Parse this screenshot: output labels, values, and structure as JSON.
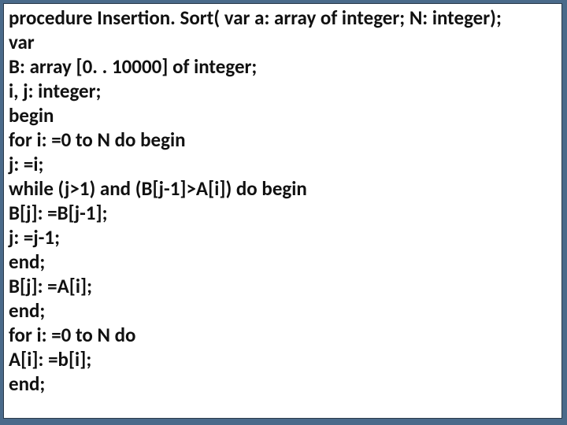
{
  "code": {
    "lines": [
      "procedure Insertion. Sort( var a: array of integer; N: integer);",
      "var",
      "B: array [0. . 10000] of integer;",
      "i, j: integer;",
      "begin",
      "for i: =0 to N do begin",
      "j: =i;",
      "while (j>1) and (B[j-1]>A[i]) do begin",
      "B[j]: =B[j-1];",
      "j: =j-1;",
      "end;",
      "B[j]: =A[i];",
      "end;",
      "for i: =0 to N do",
      "A[i]: =b[i];",
      "end;"
    ]
  }
}
